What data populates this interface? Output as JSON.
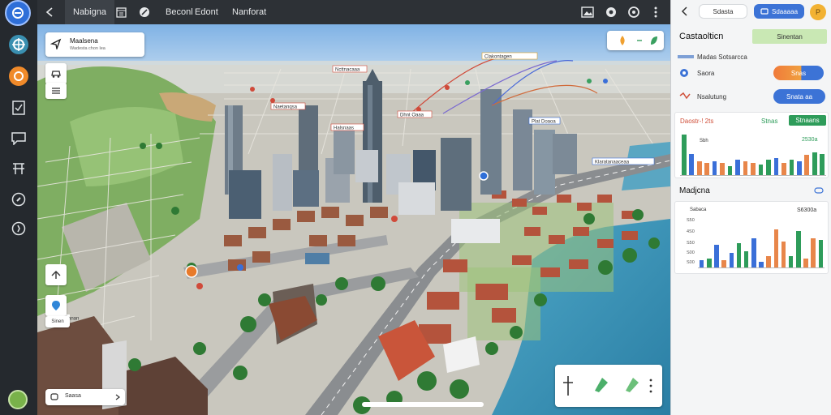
{
  "topbar": {
    "tab_label": "Nabigna",
    "item_1": "Beconl",
    "item_2": "Edont",
    "item_3": "Nanforat"
  },
  "map": {
    "search_card": {
      "title": "Maalsena",
      "subtitle": "Wadesta chon lea"
    },
    "bottom_search": {
      "value": "Saasa"
    },
    "scale_label": "Sinen",
    "tags": [
      "Ncttnacaaa",
      "Clakontagen",
      "Naetanqsa",
      "Halsnaas",
      "Dhnt Oaaa",
      "Plat Doaoa",
      "Klaratanaaceaa",
      "Elsc Dloanan"
    ]
  },
  "panel": {
    "search_placeholder": "Sdasta",
    "share_label": "Sdaaaaa",
    "title": "Castaolticn",
    "title_badge": "Sinentan",
    "subtitle": "Madas Sotsarcca",
    "row_1_label": "Saora",
    "row_1_toggle": "Snas",
    "row_2_label": "Nsalutung",
    "row_2_button": "Snata aa",
    "chart_1": {
      "title": "Daostr-! 2ts",
      "stat": "Stnas",
      "badge": "Stnaans",
      "y_top": "2530a",
      "y_label": "Sbh"
    },
    "section_2_title": "Madjcna",
    "chart_2": {
      "legend": "Sabaca",
      "stat": "S6300a",
      "y_ticks": [
        "S50",
        "4S0",
        "S50",
        "S00",
        "S00"
      ]
    }
  },
  "chart_data": [
    {
      "type": "bar",
      "title": "Daostr-! 2ts",
      "values": [
        52,
        28,
        18,
        16,
        18,
        16,
        12,
        20,
        18,
        16,
        14,
        20,
        22,
        16,
        20,
        18,
        26,
        30,
        28
      ],
      "colors": [
        "#2e9c5a",
        "#3a6fd8",
        "#e8864a",
        "#e8864a",
        "#3a6fd8",
        "#e8864a",
        "#2e9c5a",
        "#3a6fd8",
        "#e8864a",
        "#e8864a",
        "#2e9c5a",
        "#2e9c5a",
        "#3a6fd8",
        "#e8864a",
        "#2e9c5a",
        "#3a6fd8",
        "#e8864a",
        "#2e9c5a",
        "#2e9c5a"
      ]
    },
    {
      "type": "bar",
      "title": "Madjcna",
      "values": [
        10,
        12,
        28,
        10,
        18,
        30,
        20,
        36,
        8,
        14,
        46,
        32,
        14,
        44,
        12,
        36,
        34
      ],
      "colors": [
        "#3a6fd8",
        "#2e9c5a",
        "#3a6fd8",
        "#e8864a",
        "#3a6fd8",
        "#2e9c5a",
        "#2e9c5a",
        "#3a6fd8",
        "#3a6fd8",
        "#e8864a",
        "#e8864a",
        "#e8864a",
        "#2e9c5a",
        "#2e9c5a",
        "#e8864a",
        "#e8864a",
        "#2e9c5a"
      ]
    }
  ]
}
